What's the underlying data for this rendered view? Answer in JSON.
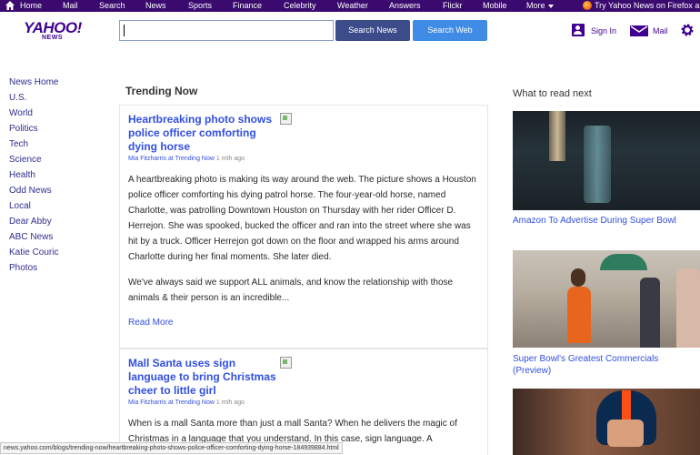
{
  "topbar": {
    "items": [
      "Home",
      "Mail",
      "Search",
      "News",
      "Sports",
      "Finance",
      "Celebrity",
      "Weather",
      "Answers",
      "Flickr",
      "Mobile",
      "More"
    ],
    "promo": "Try Yahoo News on Firefox a"
  },
  "header": {
    "logo_brand": "YAHOO!",
    "logo_sub": "NEWS",
    "search_value": "",
    "search_news_label": "Search News",
    "search_web_label": "Search Web",
    "signin_label": "Sign In",
    "mail_label": "Mail"
  },
  "sidebar": {
    "items": [
      "News Home",
      "U.S.",
      "World",
      "Politics",
      "Tech",
      "Science",
      "Health",
      "Odd News",
      "Local",
      "Dear Abby",
      "ABC News",
      "Katie Couric",
      "Photos"
    ]
  },
  "main": {
    "section_title": "Trending Now",
    "articles": [
      {
        "headline": "Heartbreaking photo shows police officer comforting dying horse",
        "author": "Mia Fitzharris at Trending Now",
        "ago": "1 mth ago",
        "paragraph1": "A heartbreaking photo is making its way around the web.  The picture shows a Houston police officer comforting his dying patrol horse.   The four-year-old horse, named Charlotte, was patrolling Downtown Houston on Thursday with her rider Officer D. Herrejon.  She was spooked, bucked the officer and ran into the street where she was hit by a truck.   Officer Herrejon got down on the floor and wrapped his arms around Charlotte during her final moments. She later died.",
        "paragraph2": "We've always said we support ALL animals, and know the relationship with those animals & their person is an incredible...",
        "read_more": "Read More"
      },
      {
        "headline": "Mall Santa uses sign language to bring Christmas cheer to little girl",
        "author": "Mia Fitzharris at Trending Now",
        "ago": "1 mth ago",
        "paragraph1": "When is a mall Santa more than just a mall Santa?  When he delivers the magic of Christmas in a language that you understand. In this case, sign language.   A"
      }
    ]
  },
  "rail": {
    "title": "What to read next",
    "items": [
      {
        "caption": "Amazon To Advertise During Super Bowl"
      },
      {
        "caption": "Super Bowl's Greatest Commercials (Preview)"
      },
      {
        "caption": ""
      }
    ]
  },
  "status_bar": {
    "url": "news.yahoo.com/blogs/trending-now/heartbreaking-photo-shows-police-officer-comforting-dying-horse-184939884.html"
  },
  "colors": {
    "topbar": "#3a0a6f",
    "brand": "#400090",
    "link": "#324fe1",
    "search_news_button": "#3c4c8a",
    "search_web_button": "#3f8be5"
  }
}
